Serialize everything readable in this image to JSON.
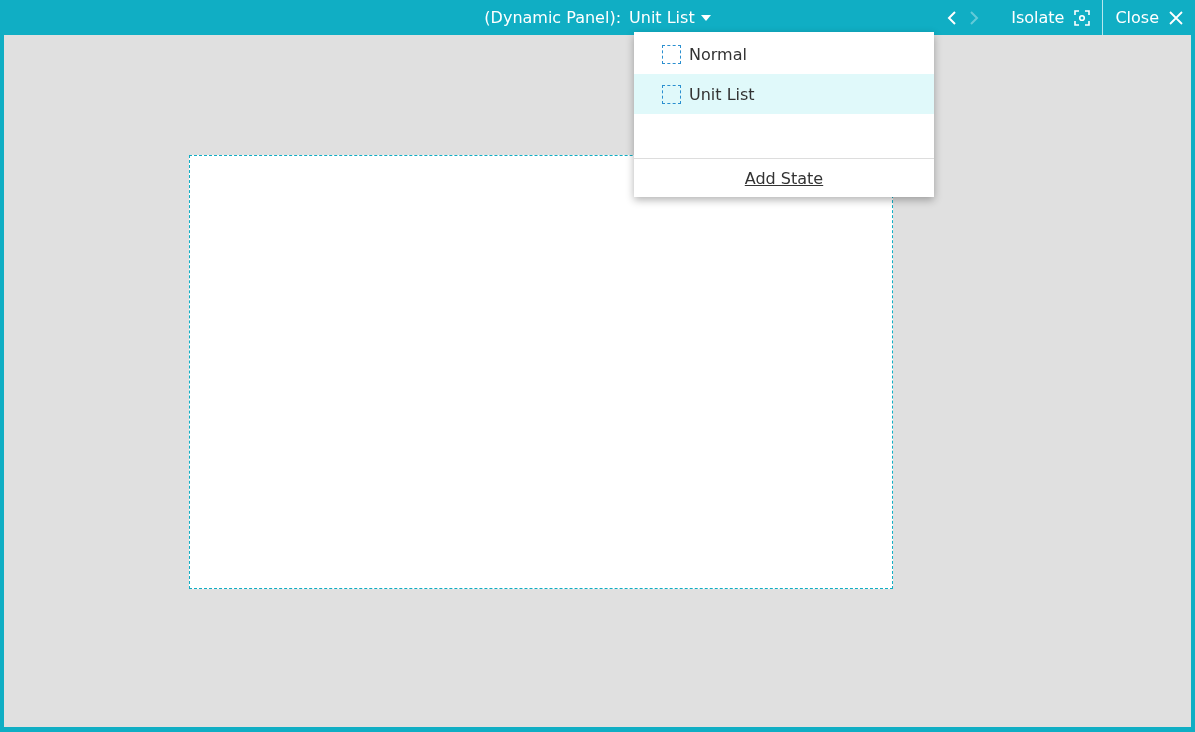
{
  "toolbar": {
    "label": "(Dynamic Panel):",
    "current_state": "Unit List",
    "prev": {
      "disabled": false
    },
    "next": {
      "disabled": true
    },
    "isolate": "Isolate",
    "close": "Close"
  },
  "state_menu": {
    "items": [
      {
        "label": "Normal",
        "selected": false
      },
      {
        "label": "Unit List",
        "selected": true
      }
    ],
    "add": "Add State"
  }
}
